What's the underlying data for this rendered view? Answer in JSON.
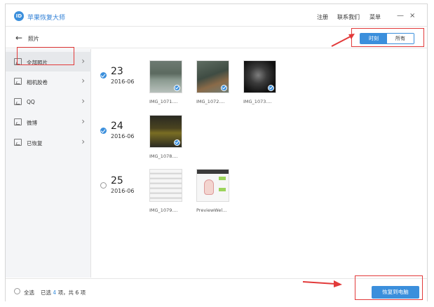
{
  "titlebar": {
    "app_title": "苹果恢复大师",
    "logo_icon": "app-logo-icon",
    "links": [
      "注册",
      "联系我们",
      "菜单"
    ],
    "minimize": "—",
    "close": "×"
  },
  "subbar": {
    "back_icon": "arrow-left-icon",
    "title": "照片",
    "segments": [
      {
        "label": "时刻",
        "active": true
      },
      {
        "label": "所有",
        "active": false
      }
    ]
  },
  "sidebar": {
    "items": [
      {
        "label": "全部照片",
        "icon": "document-icon",
        "active": true
      },
      {
        "label": "相机胶卷",
        "icon": "image-icon",
        "active": false
      },
      {
        "label": "QQ",
        "icon": "image-icon",
        "active": false
      },
      {
        "label": "微博",
        "icon": "image-icon",
        "active": false
      },
      {
        "label": "已恢复",
        "icon": "image-icon",
        "active": false
      }
    ],
    "chevron": "›"
  },
  "groups": [
    {
      "day": "23",
      "month": "2016-06",
      "checked": true,
      "photos": [
        {
          "name": "IMG_1071....",
          "checked": true
        },
        {
          "name": "IMG_1072....",
          "checked": true
        },
        {
          "name": "IMG_1073....",
          "checked": true
        }
      ]
    },
    {
      "day": "24",
      "month": "2016-06",
      "checked": true,
      "photos": [
        {
          "name": "IMG_1078....",
          "checked": true
        }
      ]
    },
    {
      "day": "25",
      "month": "2016-06",
      "checked": false,
      "photos": [
        {
          "name": "IMG_1079....",
          "checked": false
        },
        {
          "name": "PreviewWel...",
          "checked": false
        }
      ]
    }
  ],
  "footer": {
    "select_all": "全选",
    "status_prefix": "已选",
    "selected_count": "4",
    "status_suffix": "项，共 6 项",
    "recover_button": "恢复到电脑"
  },
  "colors": {
    "accent": "#3b8fdc",
    "annotation": "#e23a3a"
  }
}
